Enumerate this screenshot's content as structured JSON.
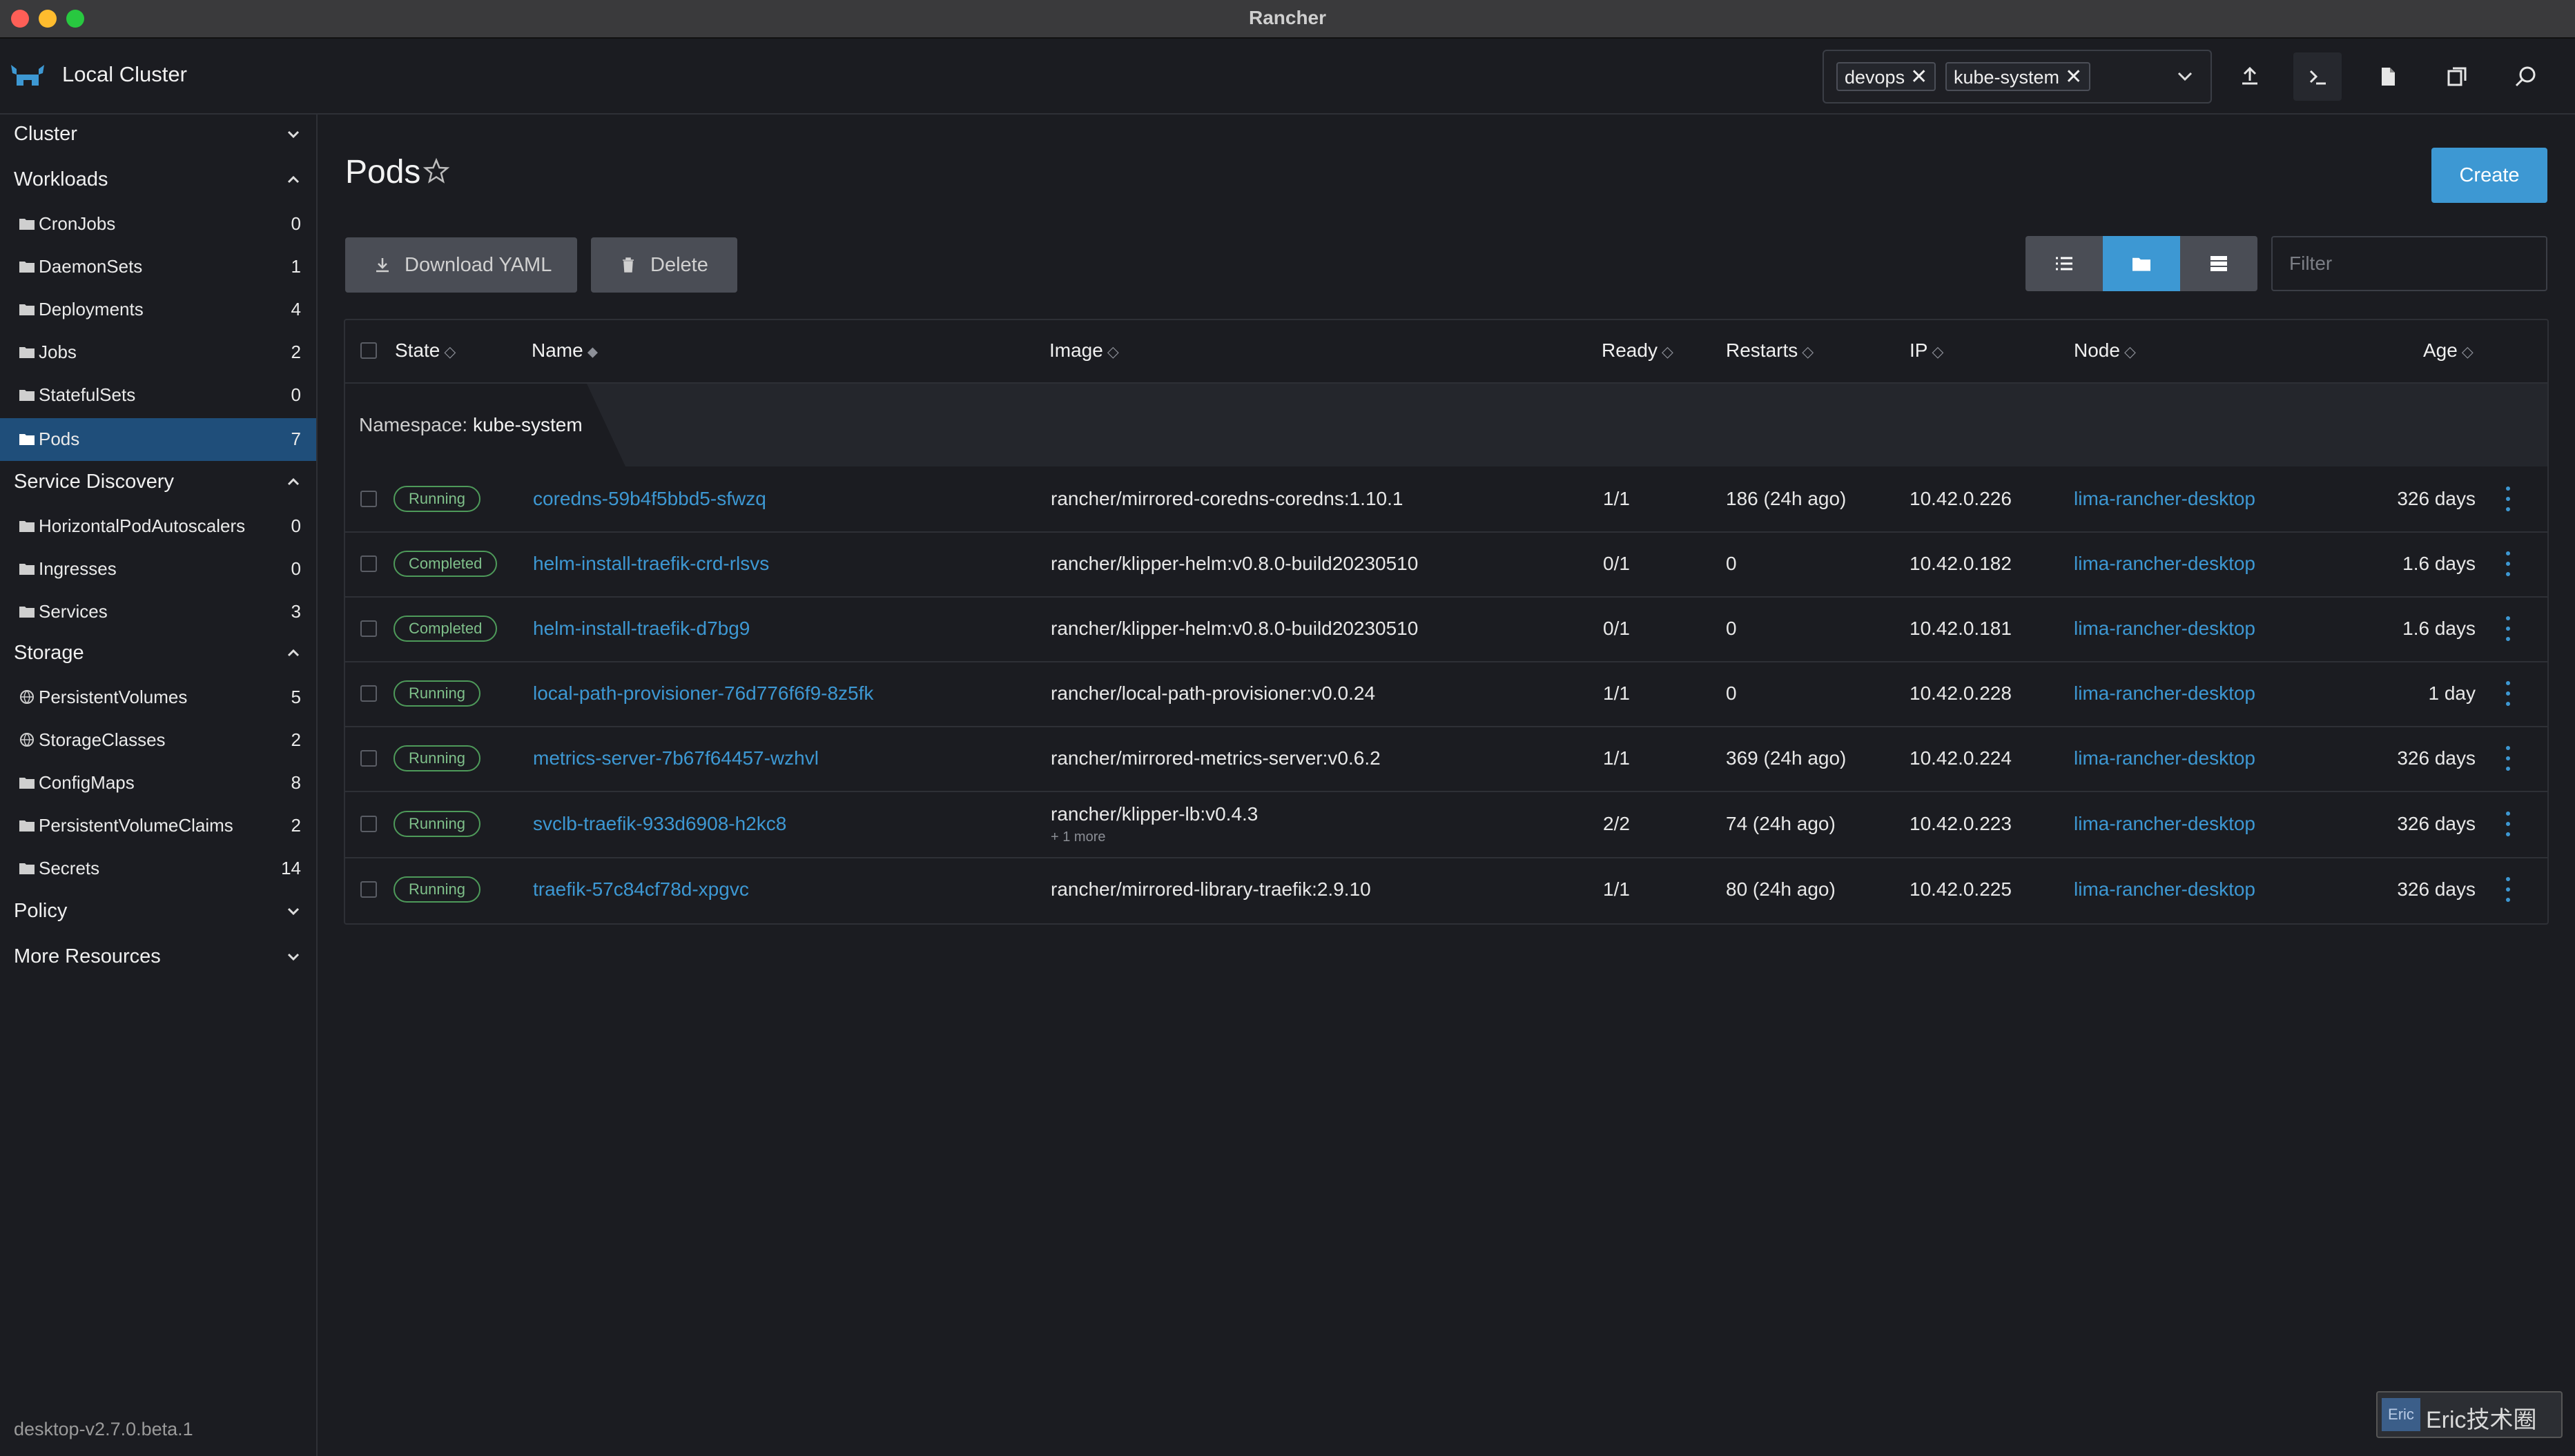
{
  "window": {
    "title": "Rancher"
  },
  "header": {
    "cluster_name": "Local Cluster",
    "namespaces": [
      "devops",
      "kube-system"
    ]
  },
  "sidebar": {
    "groups": {
      "cluster": "Cluster",
      "workloads": "Workloads",
      "service_discovery": "Service Discovery",
      "storage": "Storage",
      "policy": "Policy",
      "more_resources": "More Resources"
    },
    "workloads": [
      {
        "label": "CronJobs",
        "count": "0"
      },
      {
        "label": "DaemonSets",
        "count": "1"
      },
      {
        "label": "Deployments",
        "count": "4"
      },
      {
        "label": "Jobs",
        "count": "2"
      },
      {
        "label": "StatefulSets",
        "count": "0"
      },
      {
        "label": "Pods",
        "count": "7"
      }
    ],
    "service_discovery": [
      {
        "label": "HorizontalPodAutoscalers",
        "count": "0"
      },
      {
        "label": "Ingresses",
        "count": "0"
      },
      {
        "label": "Services",
        "count": "3"
      }
    ],
    "storage": [
      {
        "label": "PersistentVolumes",
        "count": "5"
      },
      {
        "label": "StorageClasses",
        "count": "2"
      },
      {
        "label": "ConfigMaps",
        "count": "8"
      },
      {
        "label": "PersistentVolumeClaims",
        "count": "2"
      },
      {
        "label": "Secrets",
        "count": "14"
      }
    ],
    "version": "desktop-v2.7.0.beta.1"
  },
  "main": {
    "title": "Pods",
    "create_label": "Create",
    "download_label": "Download YAML",
    "delete_label": "Delete",
    "filter_placeholder": "Filter",
    "namespace_prefix": "Namespace:",
    "namespace_name": "kube-system"
  },
  "table": {
    "columns": [
      "State",
      "Name",
      "Image",
      "Ready",
      "Restarts",
      "IP",
      "Node",
      "Age"
    ],
    "rows": [
      {
        "state": "Running",
        "name": "coredns-59b4f5bbd5-sfwzq",
        "image": "rancher/mirrored-coredns-coredns:1.10.1",
        "image_more": "",
        "ready": "1/1",
        "restarts": "186 (24h ago)",
        "ip": "10.42.0.226",
        "node": "lima-rancher-desktop",
        "age": "326 days"
      },
      {
        "state": "Completed",
        "name": "helm-install-traefik-crd-rlsvs",
        "image": "rancher/klipper-helm:v0.8.0-build20230510",
        "image_more": "",
        "ready": "0/1",
        "restarts": "0",
        "ip": "10.42.0.182",
        "node": "lima-rancher-desktop",
        "age": "1.6 days"
      },
      {
        "state": "Completed",
        "name": "helm-install-traefik-d7bg9",
        "image": "rancher/klipper-helm:v0.8.0-build20230510",
        "image_more": "",
        "ready": "0/1",
        "restarts": "0",
        "ip": "10.42.0.181",
        "node": "lima-rancher-desktop",
        "age": "1.6 days"
      },
      {
        "state": "Running",
        "name": "local-path-provisioner-76d776f6f9-8z5fk",
        "image": "rancher/local-path-provisioner:v0.0.24",
        "image_more": "",
        "ready": "1/1",
        "restarts": "0",
        "ip": "10.42.0.228",
        "node": "lima-rancher-desktop",
        "age": "1 day"
      },
      {
        "state": "Running",
        "name": "metrics-server-7b67f64457-wzhvl",
        "image": "rancher/mirrored-metrics-server:v0.6.2",
        "image_more": "",
        "ready": "1/1",
        "restarts": "369 (24h ago)",
        "ip": "10.42.0.224",
        "node": "lima-rancher-desktop",
        "age": "326 days"
      },
      {
        "state": "Running",
        "name": "svclb-traefik-933d6908-h2kc8",
        "image": "rancher/klipper-lb:v0.4.3",
        "image_more": "+ 1 more",
        "ready": "2/2",
        "restarts": "74 (24h ago)",
        "ip": "10.42.0.223",
        "node": "lima-rancher-desktop",
        "age": "326 days"
      },
      {
        "state": "Running",
        "name": "traefik-57c84cf78d-xpgvc",
        "image": "rancher/mirrored-library-traefik:2.9.10",
        "image_more": "",
        "ready": "1/1",
        "restarts": "80 (24h ago)",
        "ip": "10.42.0.225",
        "node": "lima-rancher-desktop",
        "age": "326 days"
      }
    ]
  },
  "watermark": {
    "badge": "Eric",
    "text": "Eric技术圈"
  },
  "colors": {
    "accent": "#3d98d3",
    "running": "#4e9a5a",
    "background": "#1b1c21",
    "sidebar_active": "#1f4e7a"
  }
}
